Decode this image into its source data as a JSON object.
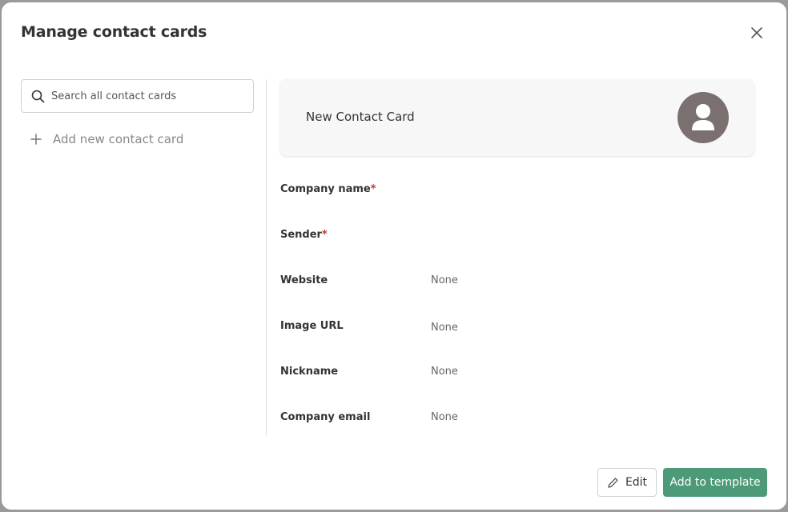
{
  "modal": {
    "title": "Manage contact cards"
  },
  "sidebar": {
    "search_placeholder": "Search all contact cards",
    "add_new_label": "Add new contact card"
  },
  "card": {
    "name": "New Contact Card",
    "avatar_icon": "user-icon"
  },
  "fields": [
    {
      "label": "Company name",
      "required": true,
      "value": ""
    },
    {
      "label": "Sender",
      "required": true,
      "value": ""
    },
    {
      "label": "Website",
      "required": false,
      "value": "None"
    },
    {
      "label": "Image URL",
      "required": false,
      "value": "None"
    },
    {
      "label": "Nickname",
      "required": false,
      "value": "None"
    },
    {
      "label": "Company email",
      "required": false,
      "value": "None"
    }
  ],
  "footer": {
    "edit_label": "Edit",
    "add_label": "Add to template"
  },
  "colors": {
    "accent": "#4d9a78",
    "required": "#c0392b",
    "avatar": "#7a7070"
  }
}
